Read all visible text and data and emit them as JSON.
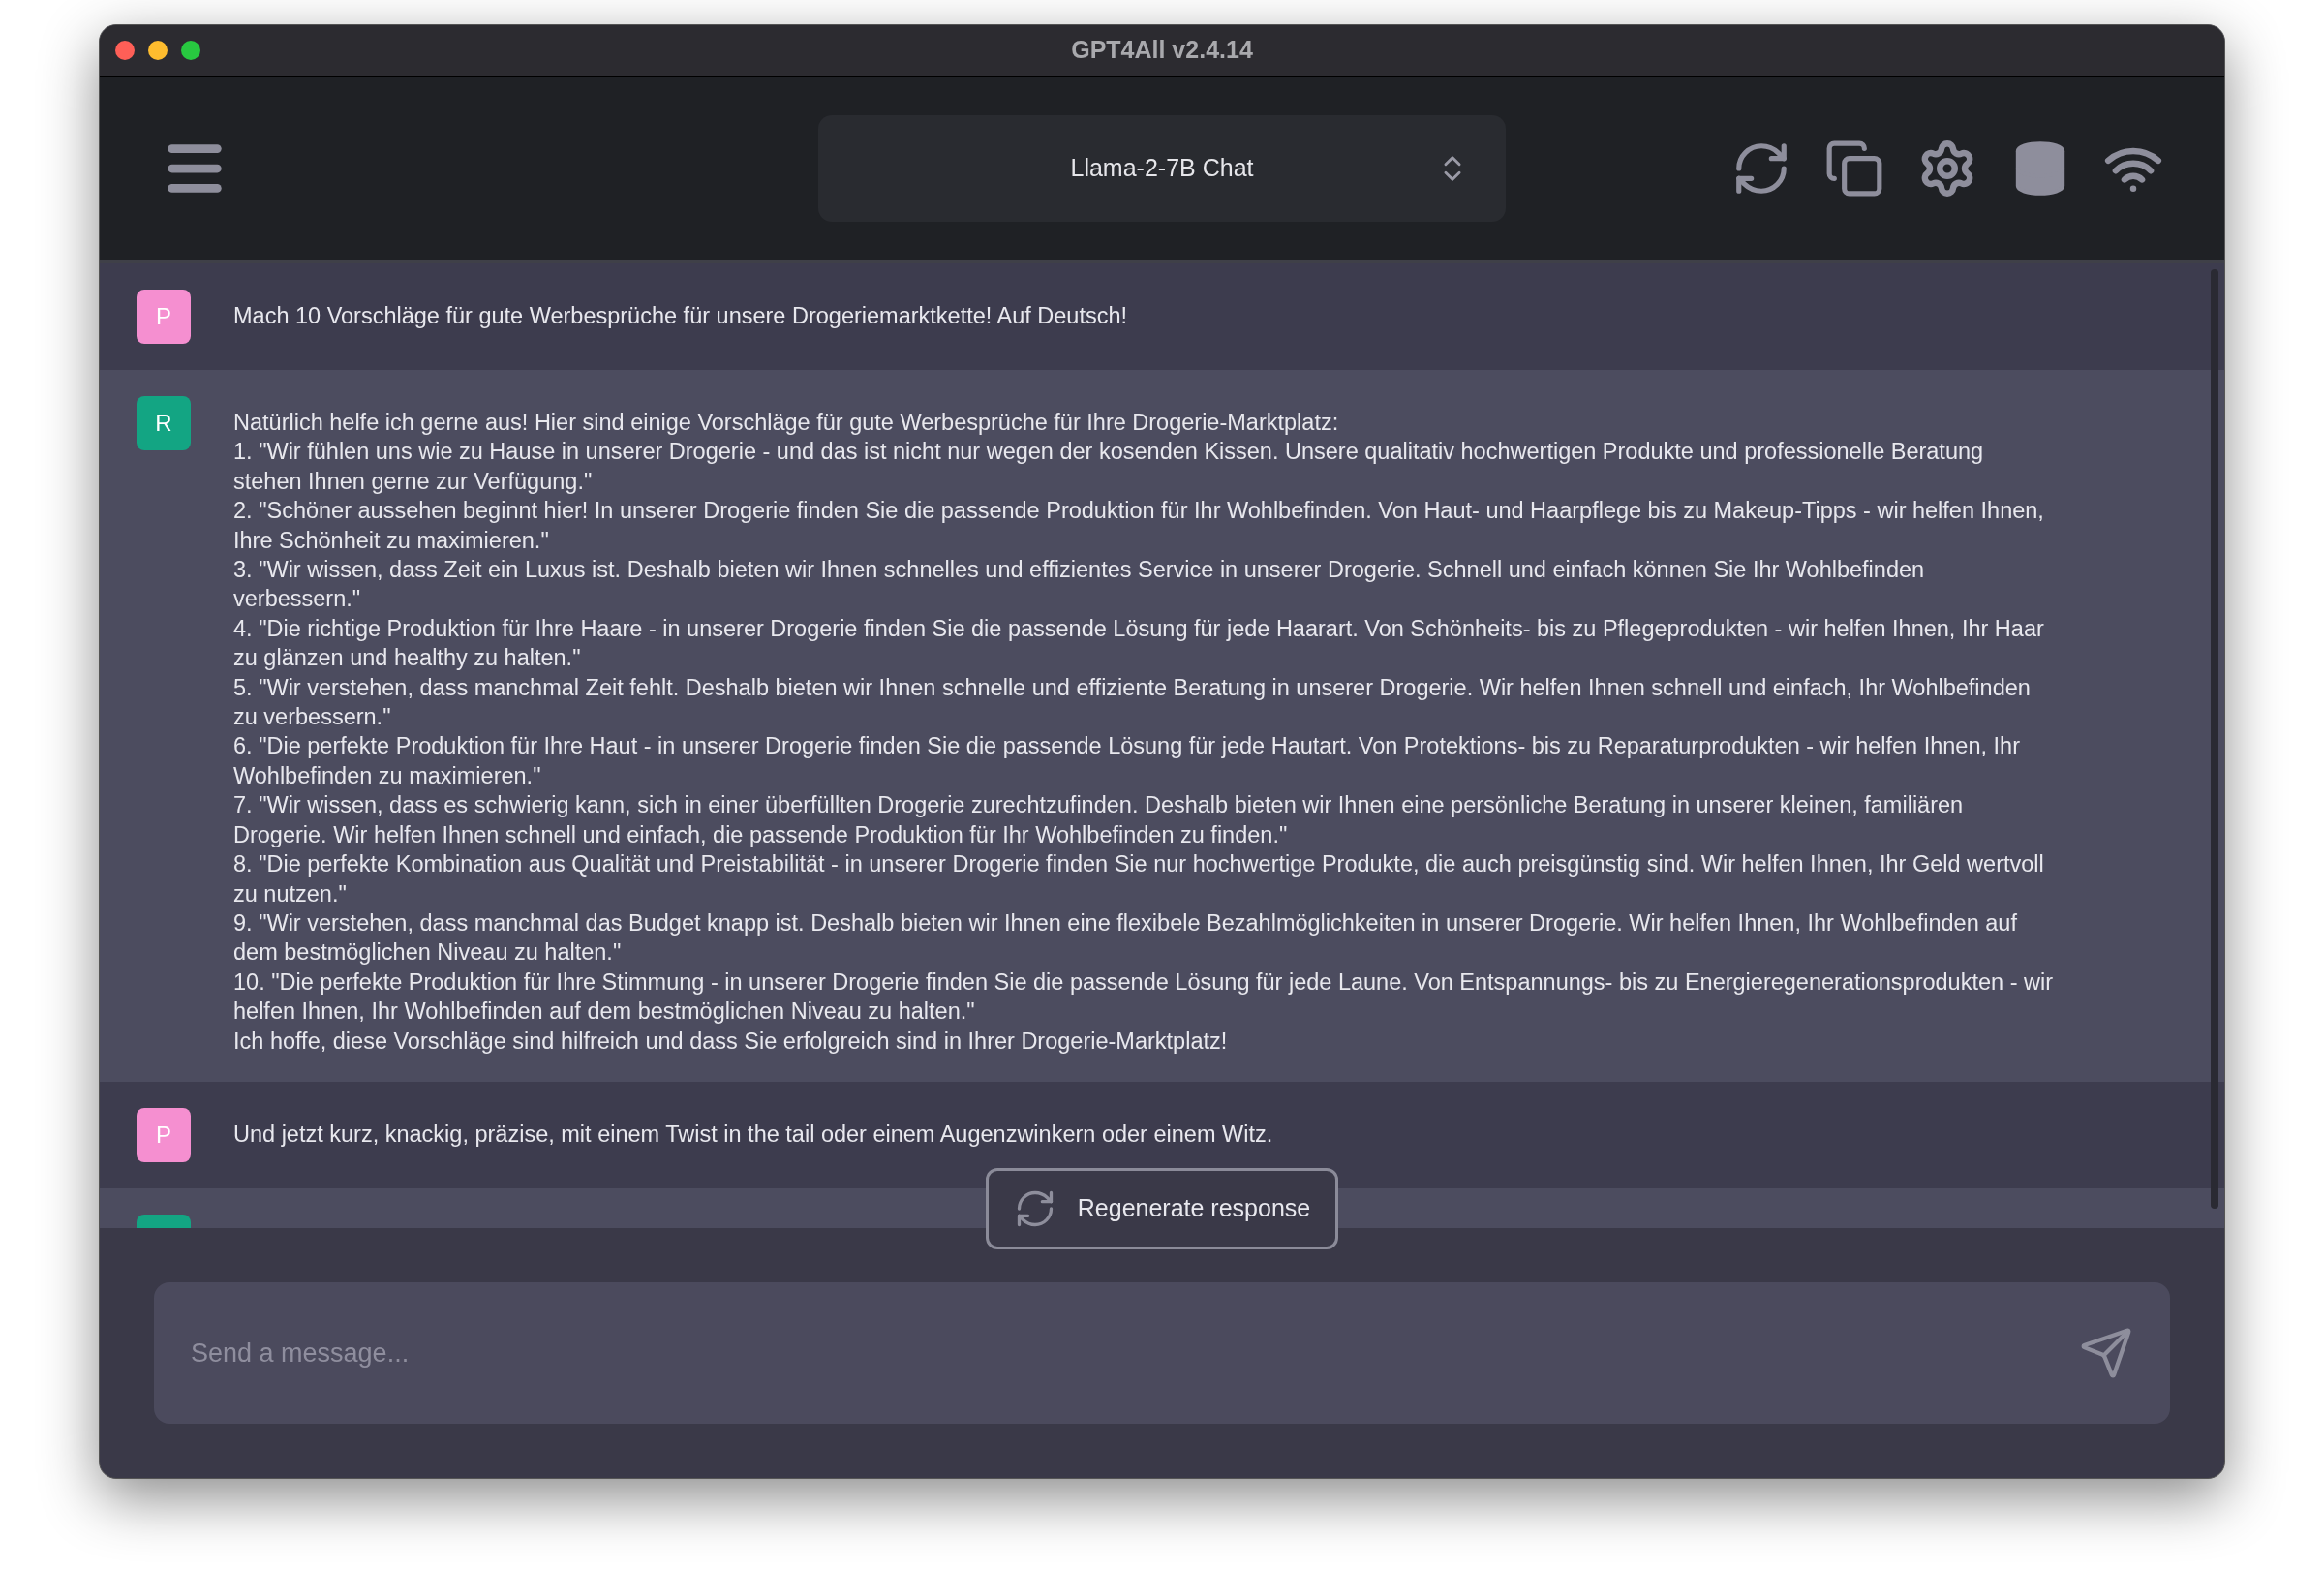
{
  "window": {
    "title": "GPT4All v2.4.14"
  },
  "model_selector": {
    "value": "Llama-2-7B Chat"
  },
  "messages": [
    {
      "kind": "prompt",
      "avatar": "P",
      "lines": [
        "Mach 10 Vorschläge für gute Werbesprüche für unsere Drogeriemarktkette! Auf Deutsch!"
      ]
    },
    {
      "kind": "response",
      "avatar": "R",
      "lines": [
        "Natürlich helfe ich gerne aus! Hier sind einige Vorschläge für gute Werbesprüche für Ihre Drogerie-Marktplatz:",
        "1. \"Wir fühlen uns wie zu Hause in unserer Drogerie - und das ist nicht nur wegen der kosenden Kissen. Unsere qualitativ hochwertigen Produkte und professionelle Beratung stehen Ihnen gerne zur Verfügung.\"",
        "2. \"Schöner aussehen beginnt hier! In unserer Drogerie finden Sie die passende Produktion für Ihr Wohlbefinden. Von Haut- und Haarpflege bis zu Makeup-Tipps - wir helfen Ihnen, Ihre Schönheit zu maximieren.\"",
        "3. \"Wir wissen, dass Zeit ein Luxus ist. Deshalb bieten wir Ihnen schnelles und effizientes Service in unserer Drogerie. Schnell und einfach können Sie Ihr Wohlbefinden verbessern.\"",
        "4. \"Die richtige Produktion für Ihre Haare - in unserer Drogerie finden Sie die passende Lösung für jede Haarart. Von Schönheits- bis zu Pflegeprodukten - wir helfen Ihnen, Ihr Haar zu glänzen und healthy zu halten.\"",
        "5. \"Wir verstehen, dass manchmal Zeit fehlt. Deshalb bieten wir Ihnen schnelle und effiziente Beratung in unserer Drogerie. Wir helfen Ihnen schnell und einfach, Ihr Wohlbefinden zu verbessern.\"",
        "6. \"Die perfekte Produktion für Ihre Haut - in unserer Drogerie finden Sie die passende Lösung für jede Hautart. Von Protektions- bis zu Reparaturprodukten - wir helfen Ihnen, Ihr Wohlbefinden zu maximieren.\"",
        "7. \"Wir wissen, dass es schwierig kann, sich in einer überfüllten Drogerie zurechtzufinden. Deshalb bieten wir Ihnen eine persönliche Beratung in unserer kleinen, familiären Drogerie. Wir helfen Ihnen schnell und einfach, die passende Produktion für Ihr Wohlbefinden zu finden.\"",
        "8. \"Die perfekte Kombination aus Qualität und Preistabilität - in unserer Drogerie finden Sie nur hochwertige Produkte, die auch preisgünstig sind. Wir helfen Ihnen, Ihr Geld wertvoll zu nutzen.\"",
        "9. \"Wir verstehen, dass manchmal das Budget knapp ist. Deshalb bieten wir Ihnen eine flexibele Bezahlmöglichkeiten in unserer Drogerie. Wir helfen Ihnen, Ihr Wohlbefinden auf dem bestmöglichen Niveau zu halten.\"",
        "10. \"Die perfekte Produktion für Ihre Stimmung - in unserer Drogerie finden Sie die passende Lösung für jede Laune. Von Entspannungs- bis zu Energieregenerationsprodukten - wir helfen Ihnen, Ihr Wohlbefinden auf dem bestmöglichen Niveau zu halten.\"",
        "Ich hoffe, diese Vorschläge sind hilfreich und dass Sie erfolgreich sind in Ihrer Drogerie-Marktplatz!"
      ]
    },
    {
      "kind": "prompt",
      "avatar": "P",
      "lines": [
        "Und jetzt kurz, knackig, präzise, mit einem Twist in the tail oder einem Augenzwinkern oder einem Witz."
      ]
    },
    {
      "kind": "response"
    }
  ],
  "regenerate_button": {
    "label": "Regenerate response"
  },
  "message_input": {
    "placeholder": "Send a message..."
  }
}
